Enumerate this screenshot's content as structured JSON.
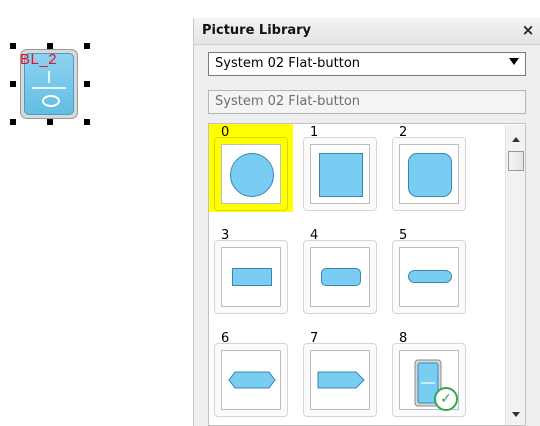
{
  "widget": {
    "label": "BL_2"
  },
  "panel": {
    "title": "Picture Library",
    "close_glyph": "×",
    "dropdown": {
      "selected": "System 02 Flat-button"
    },
    "name_field": {
      "value": "System 02 Flat-button"
    },
    "selected_index": 0,
    "items": [
      {
        "label": "0",
        "shape": "circle-icon"
      },
      {
        "label": "1",
        "shape": "square-icon"
      },
      {
        "label": "2",
        "shape": "rounded-square-icon"
      },
      {
        "label": "3",
        "shape": "rectangle-icon"
      },
      {
        "label": "4",
        "shape": "rounded-rectangle-icon"
      },
      {
        "label": "5",
        "shape": "pill-icon"
      },
      {
        "label": "6",
        "shape": "hexagon-icon"
      },
      {
        "label": "7",
        "shape": "arrow-right-icon"
      },
      {
        "label": "8",
        "shape": "rocker-switch-icon"
      }
    ]
  },
  "colors": {
    "accent": "#79ccf2",
    "selection": "#ffff00",
    "label_red": "#e0122a",
    "check_green": "#2fa84f"
  }
}
